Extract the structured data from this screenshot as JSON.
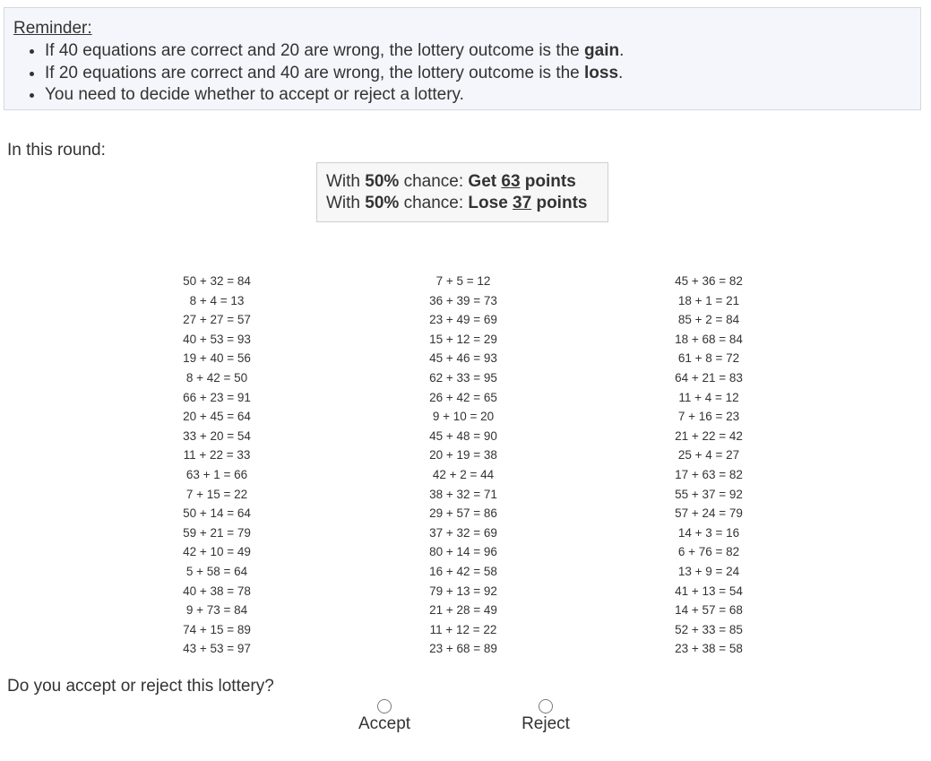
{
  "reminder": {
    "title": "Reminder:",
    "item1_pre": "If 40 equations are correct and 20 are wrong, the lottery outcome is the ",
    "item1_bold": "gain",
    "item1_post": ".",
    "item2_pre": "If 20 equations are correct and 40 are wrong, the lottery outcome is the ",
    "item2_bold": "loss",
    "item2_post": ".",
    "item3": "You need to decide whether to accept or reject a lottery."
  },
  "round_label": "In this round:",
  "offer": {
    "line1_pre": "With ",
    "line1_pct": "50%",
    "line1_mid": " chance: ",
    "line1_action": "Get ",
    "line1_amount": "63",
    "line1_unit": " points",
    "line2_pre": "With ",
    "line2_pct": "50%",
    "line2_mid": " chance: ",
    "line2_action": "Lose ",
    "line2_amount": "37",
    "line2_unit": " points"
  },
  "equations": {
    "col1": [
      "50 + 32 = 84",
      "8 + 4 = 13",
      "27 + 27 = 57",
      "40 + 53 = 93",
      "19 + 40 = 56",
      "8 + 42 = 50",
      "66 + 23 = 91",
      "20 + 45 = 64",
      "33 + 20 = 54",
      "11 + 22 = 33",
      "63 + 1 = 66",
      "7 + 15 = 22",
      "50 + 14 = 64",
      "59 + 21 = 79",
      "42 + 10 = 49",
      "5 + 58 = 64",
      "40 + 38 = 78",
      "9 + 73 = 84",
      "74 + 15 = 89",
      "43 + 53 = 97"
    ],
    "col2": [
      "7 + 5 = 12",
      "36 + 39 = 73",
      "23 + 49 = 69",
      "15 + 12 = 29",
      "45 + 46 = 93",
      "62 + 33 = 95",
      "26 + 42 = 65",
      "9 + 10 = 20",
      "45 + 48 = 90",
      "20 + 19 = 38",
      "42 + 2 = 44",
      "38 + 32 = 71",
      "29 + 57 = 86",
      "37 + 32 = 69",
      "80 + 14 = 96",
      "16 + 42 = 58",
      "79 + 13 = 92",
      "21 + 28 = 49",
      "11 + 12 = 22",
      "23 + 68 = 89"
    ],
    "col3": [
      "45 + 36 = 82",
      "18 + 1 = 21",
      "85 + 2 = 84",
      "18 + 68 = 84",
      "61 + 8 = 72",
      "64 + 21 = 83",
      "11 + 4 = 12",
      "7 + 16 = 23",
      "21 + 22 = 42",
      "25 + 4 = 27",
      "17 + 63 = 82",
      "55 + 37 = 92",
      "57 + 24 = 79",
      "14 + 3 = 16",
      "6 + 76 = 82",
      "13 + 9 = 24",
      "41 + 13 = 54",
      "14 + 57 = 68",
      "52 + 33 = 85",
      "23 + 38 = 58"
    ]
  },
  "question": "Do you accept or reject this lottery?",
  "choices": {
    "accept": "Accept",
    "reject": "Reject"
  }
}
